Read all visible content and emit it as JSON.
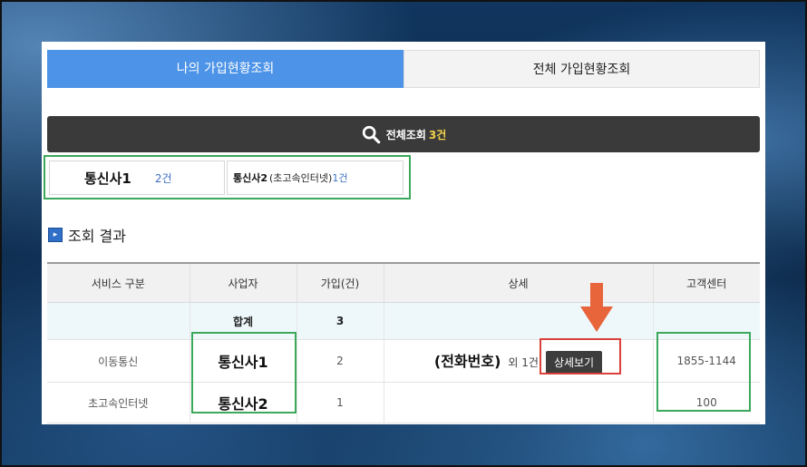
{
  "tabs": [
    {
      "label": "나의 가입현황조회",
      "active": true
    },
    {
      "label": "전체 가입현황조회",
      "active": false
    }
  ],
  "search_bar": {
    "label": "전체조회",
    "count": "3건"
  },
  "carrier_cards": [
    {
      "name": "통신사1",
      "count": "2건"
    },
    {
      "name": "통신사2",
      "sub": "(초고속인터넷)",
      "count": "1건"
    }
  ],
  "section": {
    "title": "조회 결과",
    "icon": "chevron-right-icon"
  },
  "table": {
    "headers": [
      "서비스 구분",
      "사업자",
      "가입(건)",
      "상세",
      "고객센터"
    ],
    "total": {
      "label": "합계",
      "count": "3"
    },
    "rows": [
      {
        "service": "이동통신",
        "carrier": "통신사1",
        "count": "2",
        "detail_phone": "(전화번호)",
        "detail_extra": "외 1건",
        "detail_button": "상세보기",
        "center": "1855-1144"
      },
      {
        "service": "초고속인터넷",
        "carrier": "통신사2",
        "count": "1",
        "detail_phone": "",
        "detail_extra": "",
        "detail_button": "",
        "center": "100"
      }
    ]
  },
  "colors": {
    "accent_blue": "#4d94e8",
    "highlight_green": "#3ca85c",
    "highlight_red": "#d9413a",
    "arrow_orange": "#e8643a",
    "count_yellow": "#f2d24b"
  }
}
